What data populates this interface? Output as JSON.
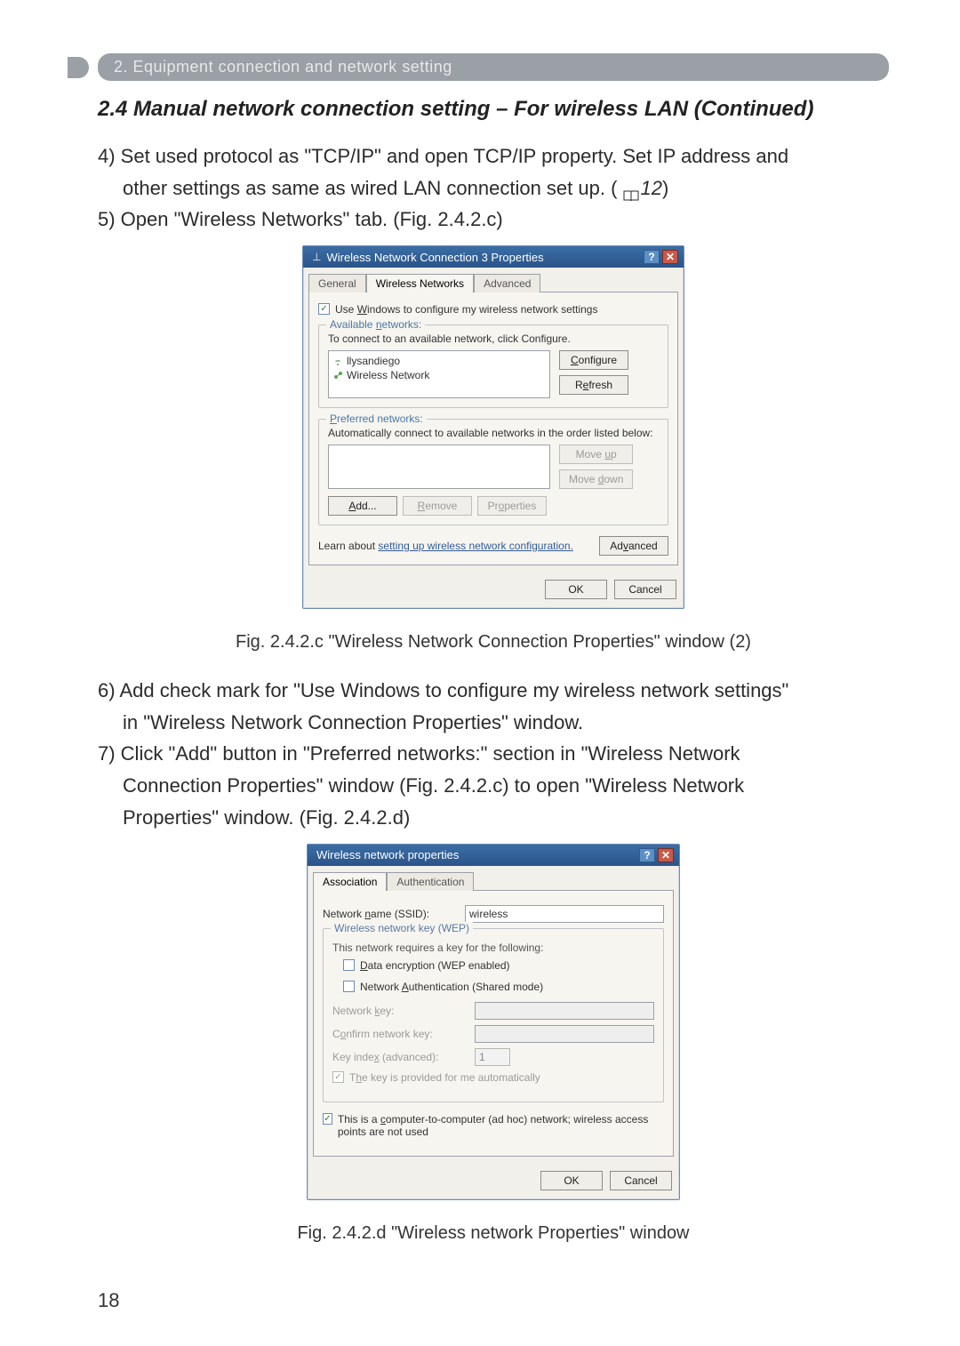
{
  "section_bar": "2. Equipment connection and network setting",
  "subsection": "2.4 Manual network connection setting – For wireless LAN (Continued)",
  "paragraphs": {
    "p4a": "4) Set used protocol as \"TCP/IP\" and open TCP/IP property. Set IP address and",
    "p4b": "other settings as same as wired LAN connection set up. (",
    "ref12": "12",
    "p4c": ")",
    "p5": "5) Open \"Wireless Networks\" tab. (Fig. 2.4.2.c)",
    "p6a": "6) Add check mark for \"Use Windows to configure my wireless network settings\"",
    "p6b": "in \"Wireless Network Connection Properties\" window.",
    "p7a": "7) Click \"Add\" button in \"Preferred networks:\" section in \"Wireless Network",
    "p7b": "Connection Properties\" window (Fig. 2.4.2.c) to open \"Wireless Network",
    "p7c": "Properties\" window. (Fig. 2.4.2.d)"
  },
  "figcaption_c": "Fig. 2.4.2.c \"Wireless Network Connection Properties\" window (2)",
  "figcaption_d": "Fig. 2.4.2.d \"Wireless network Properties\" window",
  "page_number": "18",
  "win1": {
    "title": "Wireless Network Connection 3 Properties",
    "help": "?",
    "close": "✕",
    "tabs": {
      "general": "General",
      "wireless": "Wireless Networks",
      "advanced": "Advanced"
    },
    "use_windows": "Use Windows to configure my wireless network settings",
    "available_group": "Available networks:",
    "available_hint": "To connect to an available network, click Configure.",
    "available_items": [
      "llysandiego",
      "Wireless Network"
    ],
    "btn_configure": "Configure",
    "btn_refresh": "Refresh",
    "preferred_group": "Preferred networks:",
    "preferred_hint": "Automatically connect to available networks in the order listed below:",
    "btn_moveup": "Move up",
    "btn_movedown": "Move down",
    "btn_add": "Add...",
    "btn_remove": "Remove",
    "btn_properties": "Properties",
    "learn_text": "Learn about ",
    "learn_link": "setting up wireless network configuration.",
    "btn_advanced": "Advanced",
    "btn_ok": "OK",
    "btn_cancel": "Cancel"
  },
  "win2": {
    "title": "Wireless network properties",
    "help": "?",
    "close": "✕",
    "tabs": {
      "assoc": "Association",
      "auth": "Authentication"
    },
    "ssid_label": "Network name (SSID):",
    "ssid_value": "wireless",
    "wep_group": "Wireless network key (WEP)",
    "wep_hint": "This network requires a key for the following:",
    "chk_data_enc": "Data encryption (WEP enabled)",
    "chk_net_auth": "Network Authentication (Shared mode)",
    "netkey_label": "Network key:",
    "confirm_label": "Confirm network key:",
    "keyindex_label": "Key index (advanced):",
    "keyindex_value": "1",
    "auto_key": "The key is provided for me automatically",
    "adhoc": "This is a computer-to-computer (ad hoc) network; wireless access points are not used",
    "btn_ok": "OK",
    "btn_cancel": "Cancel"
  }
}
